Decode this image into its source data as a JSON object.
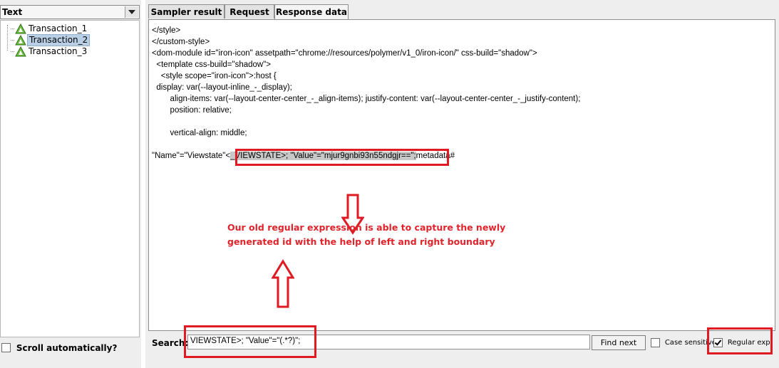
{
  "left": {
    "renderer_label": "Text",
    "tree_items": [
      {
        "label": "Transaction_1",
        "selected": false
      },
      {
        "label": "Transaction_2",
        "selected": true
      },
      {
        "label": "Transaction_3",
        "selected": false
      }
    ],
    "scroll_auto_label": "Scroll automatically?"
  },
  "tabs": [
    {
      "label": "Sampler result",
      "active": false
    },
    {
      "label": "Request",
      "active": false
    },
    {
      "label": "Response data",
      "active": true
    }
  ],
  "response": {
    "lines": [
      "</style>",
      "</custom-style>",
      "<dom-module id=\"iron-icon\" assetpath=\"chrome://resources/polymer/v1_0/iron-icon/\" css-build=\"shadow\">",
      "  <template css-build=\"shadow\">",
      "    <style scope=\"iron-icon\">:host {",
      "  display: var(--layout-inline_-_display);",
      "        align-items: var(--layout-center-center_-_align-items); justify-content: var(--layout-center-center_-_justify-content);",
      "        position: relative;",
      "        vertical-align: middle;"
    ],
    "viewstate_prefix": "\"Name\"=\"Viewstate\"<",
    "viewstate_highlight": "_VIEWSTATE>; \"Value\"=\"mjur9gnbi93n55ndgjr==\";",
    "viewstate_suffix": "metadata#"
  },
  "annotation": {
    "line1": "Our old regular expression is able to capture the newly",
    "line2": "generated id with the help of left and right boundary",
    "color": "#e0242b"
  },
  "search": {
    "label": "Search:",
    "value": "VIEWSTATE>; \"Value\"=\"(.*?)\";",
    "find_next_label": "Find next",
    "case_sensitive_label": "Case sensitive",
    "case_sensitive_checked": false,
    "regex_label": "Regular exp",
    "regex_checked": true
  }
}
